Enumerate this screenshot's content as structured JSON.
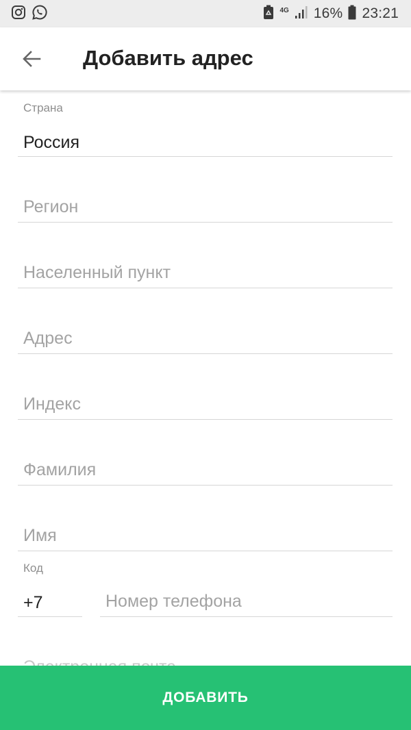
{
  "status_bar": {
    "left_icons": [
      "instagram-icon",
      "whatsapp-icon"
    ],
    "right_icons": [
      "recycle-box-icon",
      "network-4g-icon",
      "signal-icon",
      "battery-icon"
    ],
    "network": "4G",
    "battery": "16%",
    "time": "23:21"
  },
  "app_bar": {
    "back_icon": "arrow-left-icon",
    "title": "Добавить адрес"
  },
  "form": {
    "country": {
      "label": "Страна",
      "value": "Россия"
    },
    "region": {
      "placeholder": "Регион"
    },
    "locality": {
      "placeholder": "Населенный пункт"
    },
    "address": {
      "placeholder": "Адрес"
    },
    "postal_code": {
      "placeholder": "Индекс"
    },
    "last_name": {
      "placeholder": "Фамилия"
    },
    "first_name": {
      "placeholder": "Имя"
    },
    "phone_code": {
      "label": "Код",
      "value": "+7"
    },
    "phone_number": {
      "placeholder": "Номер телефона"
    },
    "email": {
      "placeholder": "Электронная почта"
    }
  },
  "actions": {
    "add_label": "ДОБАВИТЬ"
  },
  "colors": {
    "accent": "#26c174",
    "status_bar_bg": "#ededed",
    "text_primary": "#222222",
    "text_hint": "#a3a3a3",
    "divider": "#d6d6d6"
  }
}
